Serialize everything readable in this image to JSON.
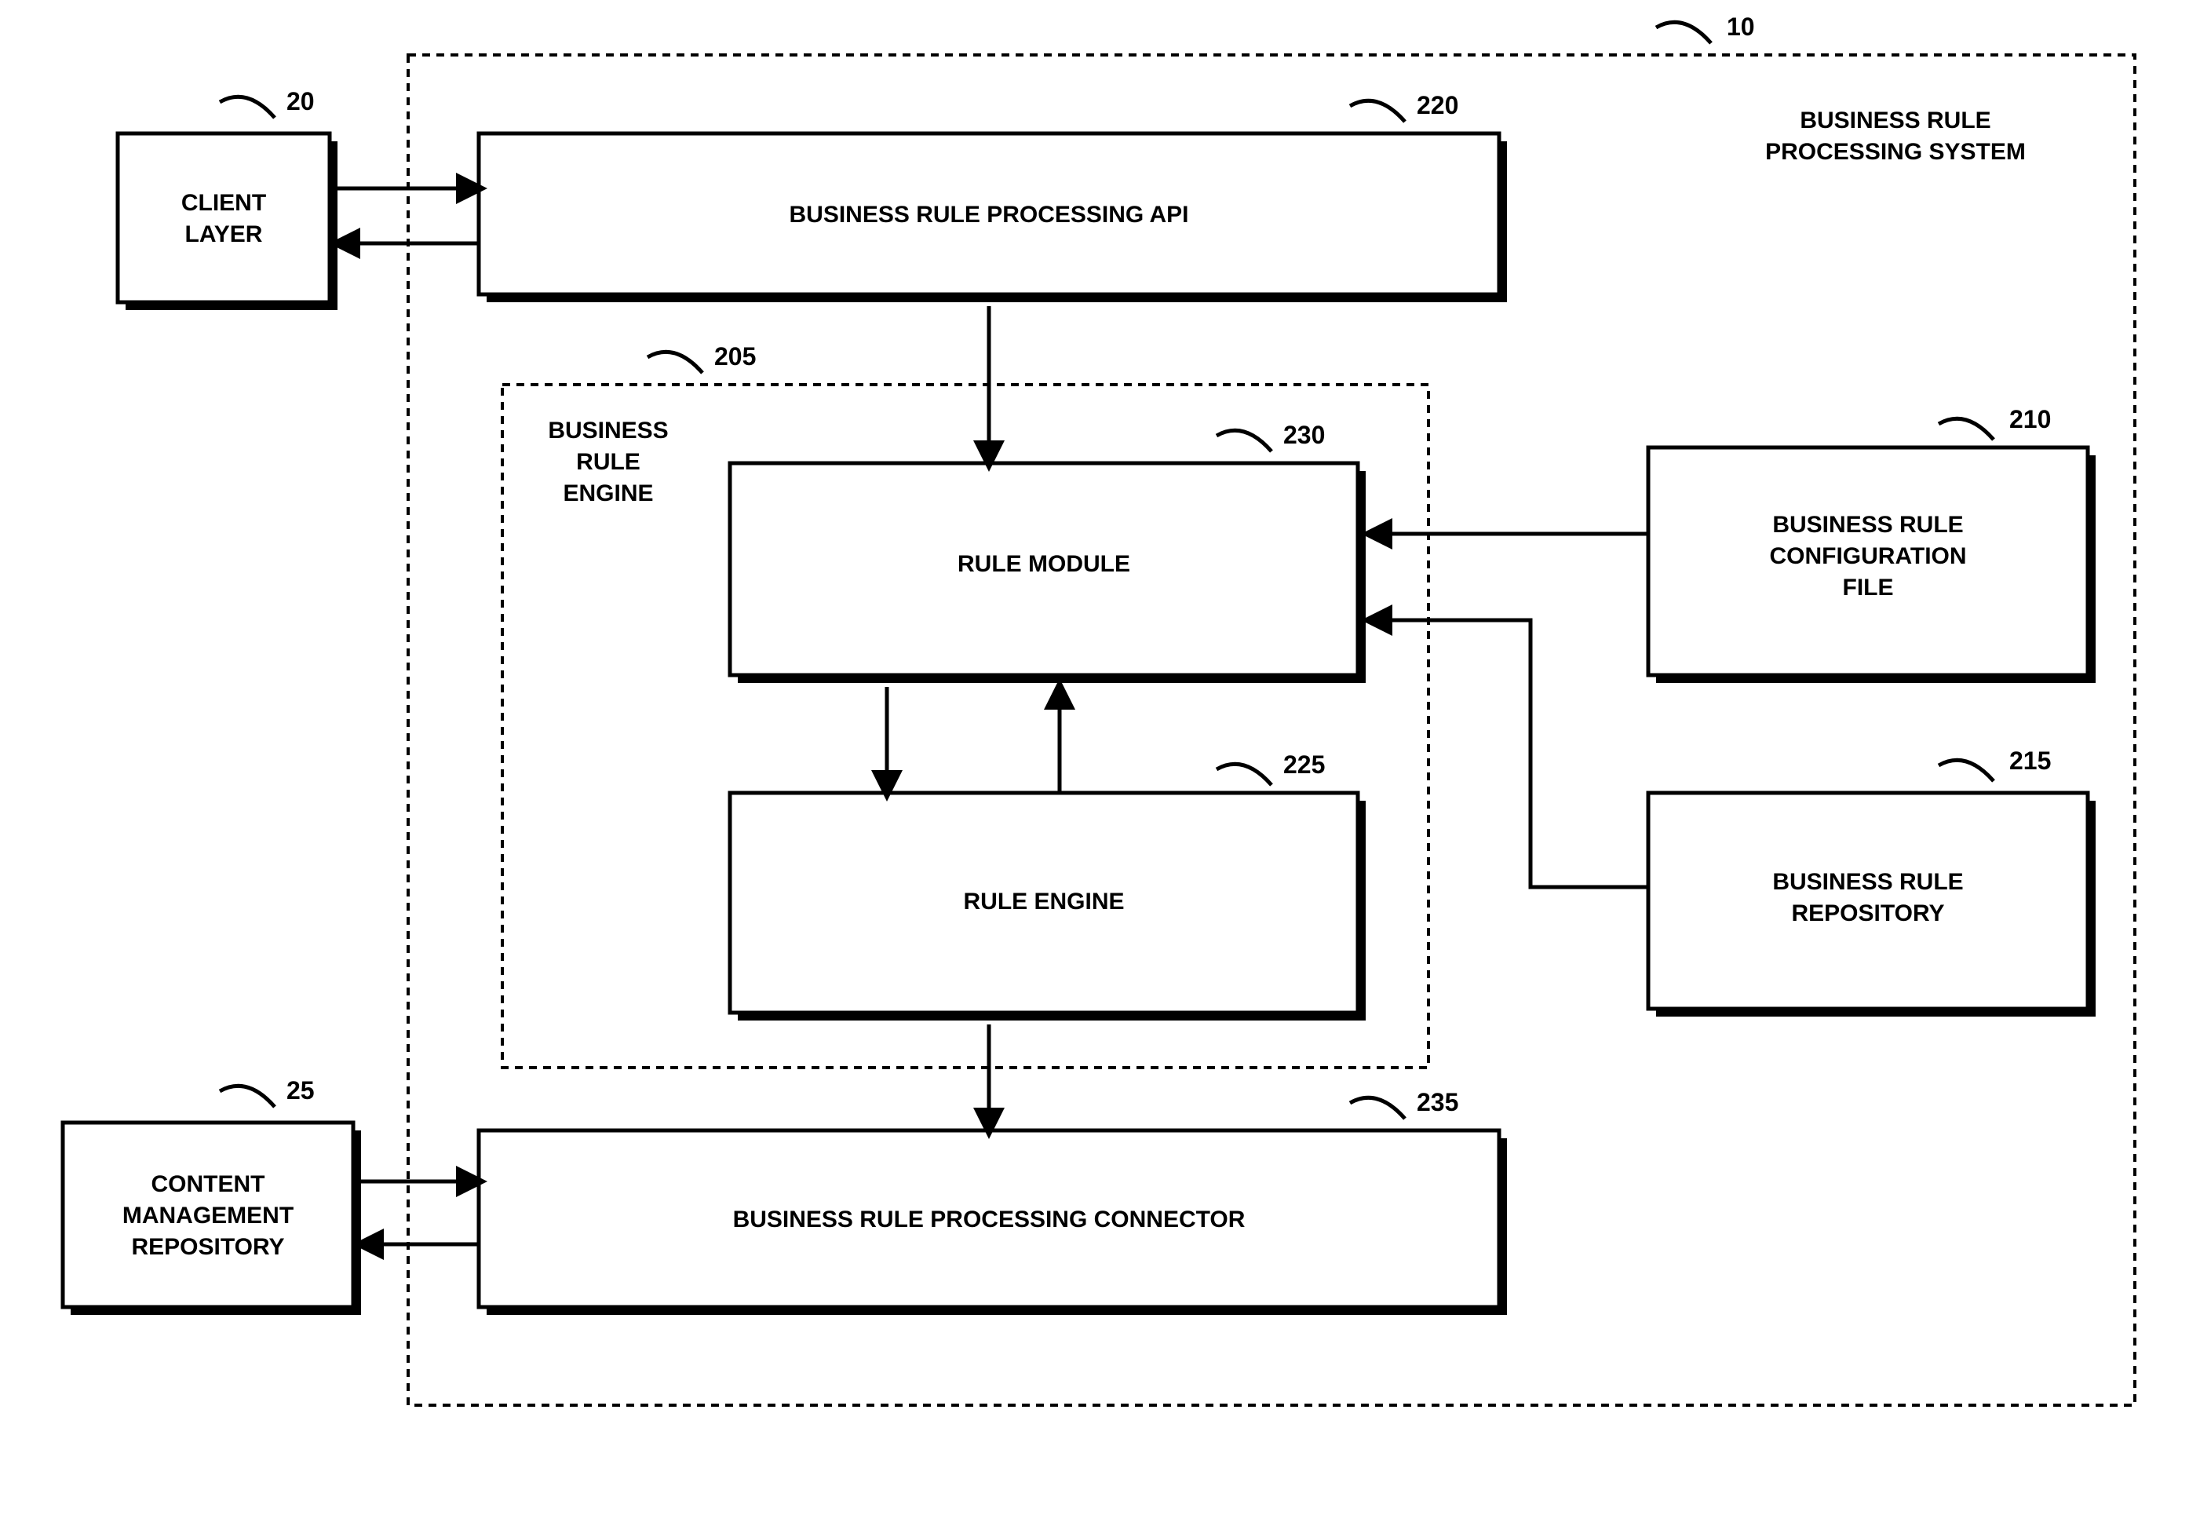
{
  "system": {
    "title_line1": "BUSINESS  RULE",
    "title_line2": "PROCESSING SYSTEM",
    "label_num": "10"
  },
  "client_layer": {
    "line1": "CLIENT",
    "line2": "LAYER",
    "label_num": "20"
  },
  "cm_repository": {
    "line1": "CONTENT",
    "line2": "MANAGEMENT",
    "line3": "REPOSITORY",
    "label_num": "25"
  },
  "api": {
    "text": "BUSINESS RULE PROCESSING API",
    "label_num": "220"
  },
  "engine_container": {
    "line1": "BUSINESS",
    "line2": "RULE",
    "line3": "ENGINE",
    "label_num": "205"
  },
  "rule_module": {
    "text": "RULE MODULE",
    "label_num": "230"
  },
  "rule_engine": {
    "text": "RULE ENGINE",
    "label_num": "225"
  },
  "config_file": {
    "line1": "BUSINESS RULE",
    "line2": "CONFIGURATION",
    "line3": "FILE",
    "label_num": "210"
  },
  "repository": {
    "line1": "BUSINESS RULE",
    "line2": "REPOSITORY",
    "label_num": "215"
  },
  "connector": {
    "text": "BUSINESS RULE PROCESSING CONNECTOR",
    "label_num": "235"
  }
}
